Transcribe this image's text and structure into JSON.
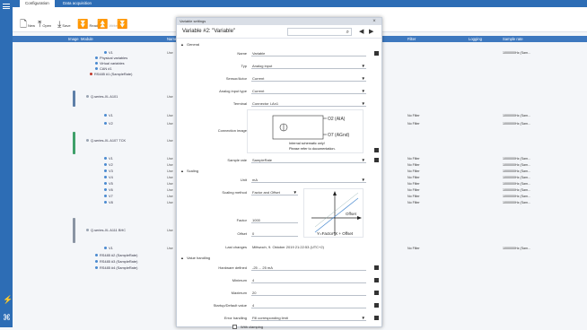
{
  "tabs": {
    "configuration": "Configuration",
    "data_acquisition": "Data acquisition"
  },
  "toolbar": {
    "new": "New",
    "open": "Open",
    "save": "Save",
    "read": "Read",
    "write": "Write"
  },
  "table_header": {
    "name": "Name",
    "image": "Image",
    "module": "Module",
    "filter": "Filter",
    "logging": "Logging",
    "sample_rate": "Sample rate"
  },
  "tree": [
    {
      "label": "V1",
      "kind": "dot"
    },
    {
      "label": "Physical variables",
      "kind": "dot"
    },
    {
      "label": "Virtual variables",
      "kind": "dot"
    },
    {
      "label": "CAN #1",
      "kind": "dot"
    },
    {
      "label": "RS485 #1 (SampleRate)",
      "kind": "red"
    },
    {
      "label": "Q.series-XL A101",
      "kind": "grey"
    },
    {
      "label": "V1",
      "kind": "dot"
    },
    {
      "label": "V2",
      "kind": "dot"
    },
    {
      "label": "Q.series-XL A107 TCK",
      "kind": "grey"
    },
    {
      "label": "V1",
      "kind": "dot"
    },
    {
      "label": "V2",
      "kind": "dot"
    },
    {
      "label": "V3",
      "kind": "dot"
    },
    {
      "label": "V4",
      "kind": "dot"
    },
    {
      "label": "V5",
      "kind": "dot"
    },
    {
      "label": "V6",
      "kind": "dot"
    },
    {
      "label": "V7",
      "kind": "dot"
    },
    {
      "label": "V8",
      "kind": "dot"
    },
    {
      "label": "Q.series-XL A111 BHC",
      "kind": "grey"
    },
    {
      "label": "V1",
      "kind": "dot"
    },
    {
      "label": "RS485 #2 (SampleRate)",
      "kind": "dot"
    },
    {
      "label": "RS485 #3 (SampleRate)",
      "kind": "dot"
    },
    {
      "label": "RS485 #4 (SampleRate)",
      "kind": "dot"
    }
  ],
  "user_col": "Use",
  "right_rows": {
    "first_rate": "1000000Hz (Sam...",
    "filter": "No Filter",
    "rate": "1000000Hz (Sam..."
  },
  "dialog": {
    "window_title": "Variable settings",
    "variable_title": "Variable #2: \"Variable\"",
    "close": "×",
    "sections": {
      "general": "General",
      "scaling": "Scaling",
      "value_handling": "Value handling"
    },
    "fields": {
      "name_label": "Name",
      "name_value": "Variable",
      "type_label": "Typ",
      "type_value": "Analog input",
      "sensor_label": "Sensor/Actor",
      "sensor_value": "Current",
      "ait_label": "Analog input type",
      "ait_value": "Current",
      "terminal_label": "Terminal",
      "terminal_value": "Connector I-An1",
      "conn_image_label": "Connection image",
      "sample_rate_label": "Sample rate",
      "sample_rate_value": "SampleRate",
      "unit_label": "Unit",
      "unit_value": "mA",
      "scaling_method_label": "Scaling method",
      "scaling_method_value": "Factor and Offset",
      "factor_label": "Factor",
      "factor_value": "1000",
      "offset_label": "Offset",
      "offset_value": "0",
      "last_changes_label": "Last changes",
      "last_changes_value": "Mittwoch, 9. Oktober 2019 21:22:53 (UTC+2)",
      "hw_defined_label": "Hardware defined",
      "hw_defined_value": "-25 ... 25 mA",
      "minimum_label": "Minimum",
      "minimum_value": "4",
      "maximum_label": "Maximum",
      "maximum_value": "20",
      "startup_label": "Startup/Default value",
      "startup_value": "4",
      "error_label": "Error handling",
      "error_value": "Fill corresponding limit",
      "with_clamping": "With clamping"
    },
    "conn_image_text": {
      "pin_a": "O2 (AIA)",
      "pin_b": "O7 (AGnd)",
      "note1": "Internal schematic only!",
      "note2": "Please refer to documentation."
    },
    "scaling_image_text": {
      "offset": "Offset",
      "formula": "Y=Factor*X + Offset"
    }
  }
}
